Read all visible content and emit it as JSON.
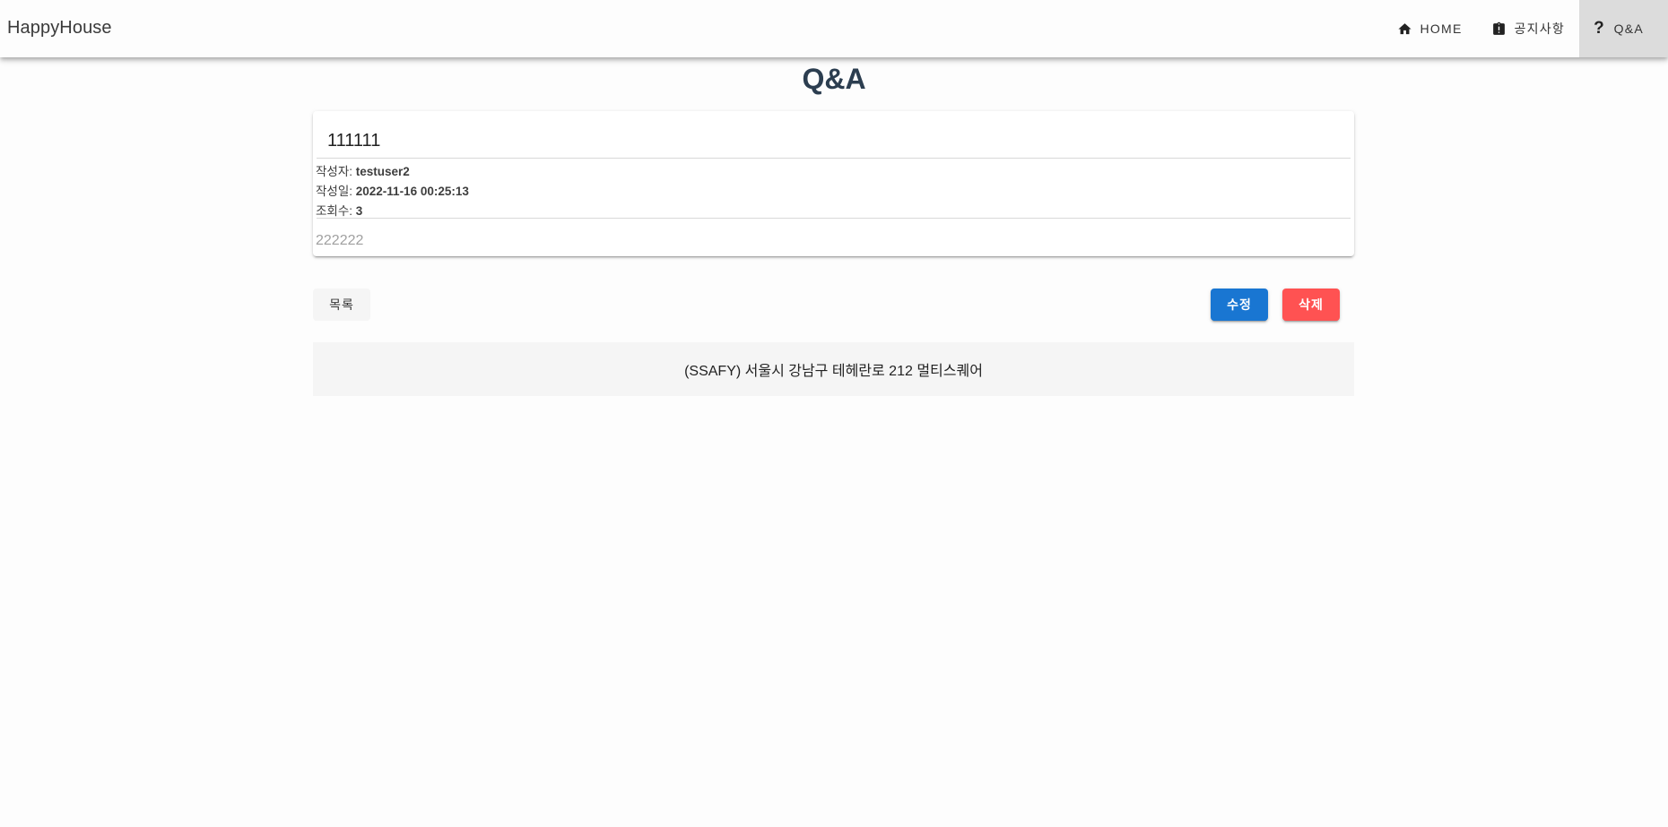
{
  "app": {
    "brand": "HappyHouse"
  },
  "nav": {
    "items": [
      {
        "label": "HOME",
        "icon": "home-icon"
      },
      {
        "label": "공지사항",
        "icon": "clipboard-alert-icon"
      },
      {
        "label": "Q&A",
        "icon": "question-mark-icon",
        "active": true
      }
    ]
  },
  "page": {
    "title": "Q&A"
  },
  "article": {
    "title": "111111",
    "author_label": "작성자: ",
    "author": "testuser2",
    "date_label": "작성일: ",
    "date": "2022-11-16 00:25:13",
    "views_label": "조회수: ",
    "views": "3",
    "content": "222222"
  },
  "actions": {
    "list_label": "목록",
    "edit_label": "수정",
    "delete_label": "삭제"
  },
  "footer": {
    "text": "(SSAFY) 서울시 강남구 테헤란로 212 멀티스퀘어"
  },
  "colors": {
    "primary": "#1976d2",
    "danger": "#ff5252",
    "title": "#2c3e50"
  }
}
